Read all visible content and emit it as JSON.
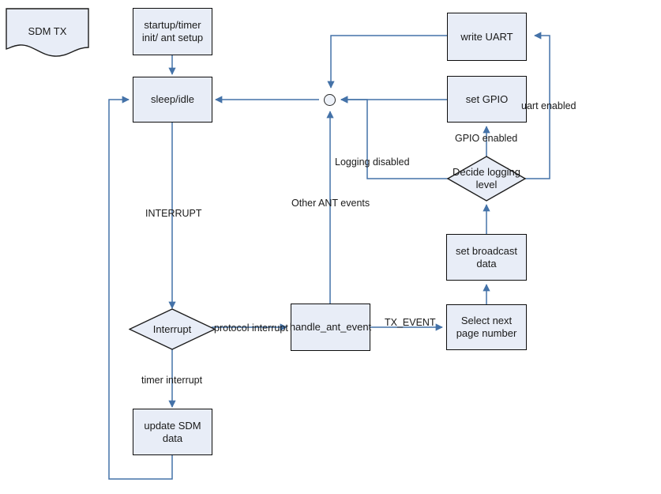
{
  "diagram": {
    "title": "SDM TX",
    "nodes": {
      "sdm_tx": "SDM TX",
      "startup": "startup/timer init/ ant setup",
      "sleep_idle": "sleep/idle",
      "interrupt": "Interrupt",
      "update_sdm": "update SDM data",
      "handle_ant_event": "handle_ant_event",
      "select_next_page": "Select next page number",
      "set_broadcast": "set broadcast data",
      "decide_logging": "Decide logging level",
      "set_gpio": "set GPIO",
      "write_uart": "write UART"
    },
    "edge_labels": {
      "interrupt": "INTERRUPT",
      "timer_interrupt": "timer interrupt",
      "protocol_interrupt": "protocol interrupt",
      "tx_event": "TX_EVENT",
      "other_ant_events": "Other ANT events",
      "logging_disabled": "Logging disabled",
      "gpio_enabled": "GPIO enabled",
      "uart_enabled": "uart enabled"
    },
    "colors": {
      "node_fill": "#e8edf7",
      "node_stroke": "#0d0d0d",
      "wire": "#4472a8",
      "text": "#1a1a1a",
      "background": "#ffffff"
    }
  }
}
